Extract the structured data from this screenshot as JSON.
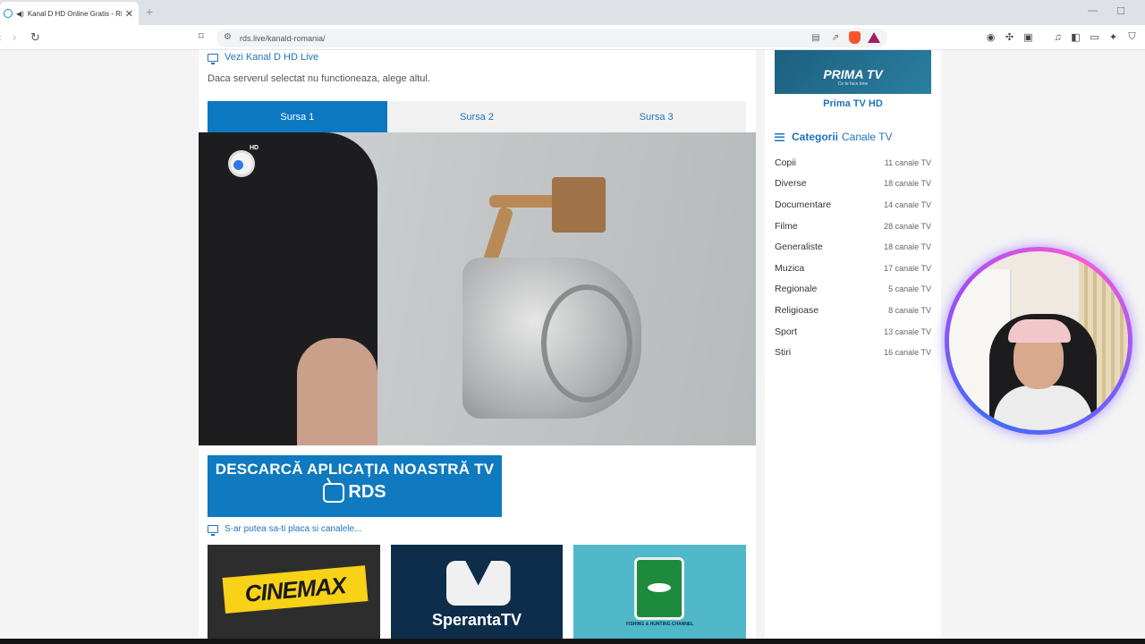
{
  "browser": {
    "tab_title": "Kanal D HD Online Gratis - RDS",
    "url": "rds.live/kanald-romania/"
  },
  "main": {
    "live_label": "Vezi Kanal D HD Live",
    "hint": "Daca serverul selectat nu functioneaza, alege altul.",
    "source_tabs": [
      "Sursa 1",
      "Sursa 2",
      "Sursa 3"
    ],
    "player_badge": "HD",
    "banner": {
      "line1": "DESCARCĂ APLICAȚIA NOASTRĂ TV",
      "brand": "RDS"
    },
    "suggest_label": "S-ar putea sa-ti placa si canalele...",
    "suggested": [
      {
        "name": "CINEMAX"
      },
      {
        "name": "SperantaTV"
      },
      {
        "name": "FISHING & HUNTING CHANNEL"
      }
    ]
  },
  "sidebar": {
    "prima_logo": "PRIMA TV",
    "prima_slogan": "Ce te face bine",
    "prima_caption": "Prima TV HD",
    "categories_title_strong": "Categorii",
    "categories_title_rest": "Canale TV",
    "categories": [
      {
        "name": "Copii",
        "count": "11 canale TV"
      },
      {
        "name": "Diverse",
        "count": "18 canale TV"
      },
      {
        "name": "Documentare",
        "count": "14 canale TV"
      },
      {
        "name": "Filme",
        "count": "28 canale TV"
      },
      {
        "name": "Generaliste",
        "count": "18 canale TV"
      },
      {
        "name": "Muzica",
        "count": "17 canale TV"
      },
      {
        "name": "Regionale",
        "count": "5 canale TV"
      },
      {
        "name": "Religioase",
        "count": "8 canale TV"
      },
      {
        "name": "Sport",
        "count": "13 canale TV"
      },
      {
        "name": "Stiri",
        "count": "16 canale TV"
      }
    ]
  },
  "colors": {
    "accent": "#1e73be",
    "active_tab": "#0d78c2",
    "banner": "#0f7ac0"
  }
}
